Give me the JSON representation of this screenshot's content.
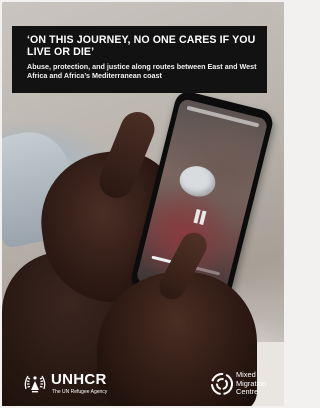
{
  "cover": {
    "title": "‘ON THIS JOURNEY, NO ONE CARES IF YOU LIVE OR DIE’",
    "subtitle": "Abuse, protection, and justice along routes between East and West Africa and Africa’s Mediterranean coast"
  },
  "phone": {
    "playback_progress": 0.45
  },
  "logos": {
    "unhcr": {
      "name": "UNHCR",
      "tagline": "The UN Refugee Agency"
    },
    "mmc": {
      "line1": "Mixed",
      "line2": "Migration",
      "line3": "Centre"
    }
  },
  "colors": {
    "title_box": "#121212",
    "title_text": "#ffffff"
  }
}
